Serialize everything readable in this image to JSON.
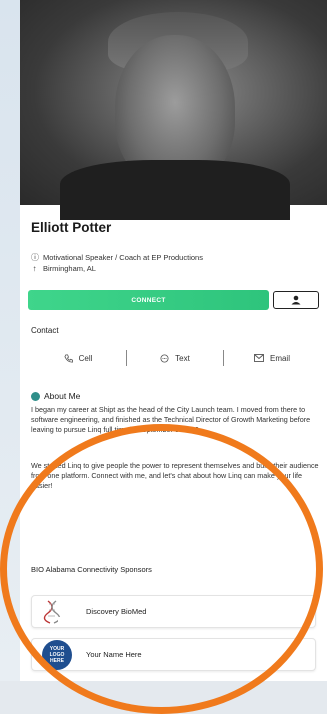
{
  "profile": {
    "name": "Elliott Potter",
    "title": "Motivational Speaker / Coach at EP Productions",
    "location": "Birmingham, AL"
  },
  "actions": {
    "connect_label": "CONNECT"
  },
  "contact": {
    "heading": "Contact",
    "items": [
      {
        "label": "Cell",
        "icon": "phone-icon"
      },
      {
        "label": "Text",
        "icon": "message-icon"
      },
      {
        "label": "Email",
        "icon": "mail-icon"
      }
    ]
  },
  "about": {
    "heading": "About Me",
    "paragraph1": "I began my career at Shipt as the head of the City Launch team. I moved from there to software engineering, and finished as the Technical Director of Growth Marketing before leaving to pursue Linq full time in September of 2019.",
    "paragraph2": "We started Linq to give people the power to represent themselves and build their audience from one platform. Connect with me, and let's chat about how Linq can make your life easier!"
  },
  "sponsors": {
    "heading": "BIO Alabama Connectivity Sponsors",
    "items": [
      {
        "name": "Discovery BioMed",
        "logo_text": "Discovery BioMed"
      },
      {
        "name": "Your Name Here",
        "logo_text": "YOUR LOGO HERE"
      }
    ]
  },
  "colors": {
    "connect_green": "#3fd58b",
    "highlight_ring": "#f07a1c",
    "about_dot": "#2f8f8a"
  }
}
